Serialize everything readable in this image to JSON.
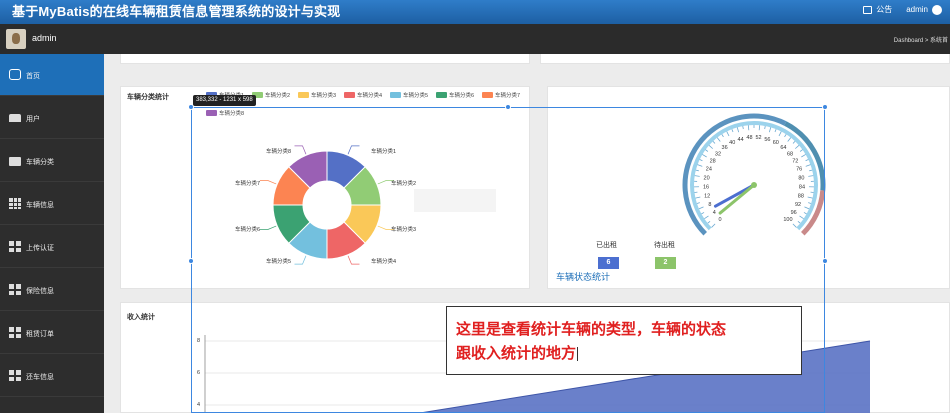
{
  "header": {
    "title": "基于MyBatis的在线车辆租赁信息管理系统的设计与实现",
    "notice_label": "公告",
    "admin_label": "admin"
  },
  "userbar": {
    "username": "admin",
    "breadcrumb": "Dashboard > 系统首"
  },
  "sidebar": {
    "items": [
      {
        "label": "首页",
        "icon": "home-icon"
      },
      {
        "label": "用户",
        "icon": "user-icon"
      },
      {
        "label": "车辆分类",
        "icon": "briefcase-icon"
      },
      {
        "label": "车辆信息",
        "icon": "grid-icon"
      },
      {
        "label": "上传认证",
        "icon": "tiles-icon"
      },
      {
        "label": "保险信息",
        "icon": "tiles-icon"
      },
      {
        "label": "租赁订单",
        "icon": "tiles-icon"
      },
      {
        "label": "还车信息",
        "icon": "tiles-icon"
      }
    ]
  },
  "category_panel": {
    "title": "车辆分类统计"
  },
  "status_panel": {
    "title": "车辆状态统计",
    "out_label": "已出租",
    "pending_label": "待出租",
    "out_value": "6",
    "pending_value": "2",
    "out_color": "#4c6fd0",
    "pending_color": "#8cc46a"
  },
  "income_panel": {
    "title": "收入统计"
  },
  "selection": {
    "dimension_tip": "383,332 - 1231 x 598"
  },
  "annotation": {
    "line1": "这里是查看统计车辆的类型，车辆的状态",
    "line2": "跟收入统计的地方"
  },
  "chart_data": [
    {
      "type": "pie",
      "title": "车辆分类统计",
      "categories": [
        "车辆分类1",
        "车辆分类2",
        "车辆分类3",
        "车辆分类4",
        "车辆分类5",
        "车辆分类6",
        "车辆分类7",
        "车辆分类8"
      ],
      "values": [
        1,
        1,
        1,
        1,
        1,
        1,
        1,
        1
      ],
      "colors": [
        "#5470c6",
        "#91cc75",
        "#fac858",
        "#ee6666",
        "#73c0de",
        "#3ba272",
        "#fc8452",
        "#9a60b4"
      ],
      "legend_position": "top"
    },
    {
      "type": "gauge",
      "min": 0,
      "max": 100,
      "ticks": [
        "0",
        "4",
        "8",
        "12",
        "16",
        "20",
        "24",
        "28",
        "32",
        "36",
        "40",
        "44",
        "48",
        "52",
        "56",
        "60",
        "64",
        "68",
        "72",
        "76",
        "80",
        "84",
        "88",
        "92",
        "96",
        "100"
      ],
      "series": [
        {
          "name": "已出租",
          "value": 6,
          "color": "#4c6fd0"
        },
        {
          "name": "待出租",
          "value": 2,
          "color": "#8cc46a"
        }
      ]
    },
    {
      "type": "area",
      "title": "收入统计",
      "yticks": [
        4,
        6,
        8
      ],
      "ylim": [
        4,
        8
      ]
    }
  ]
}
